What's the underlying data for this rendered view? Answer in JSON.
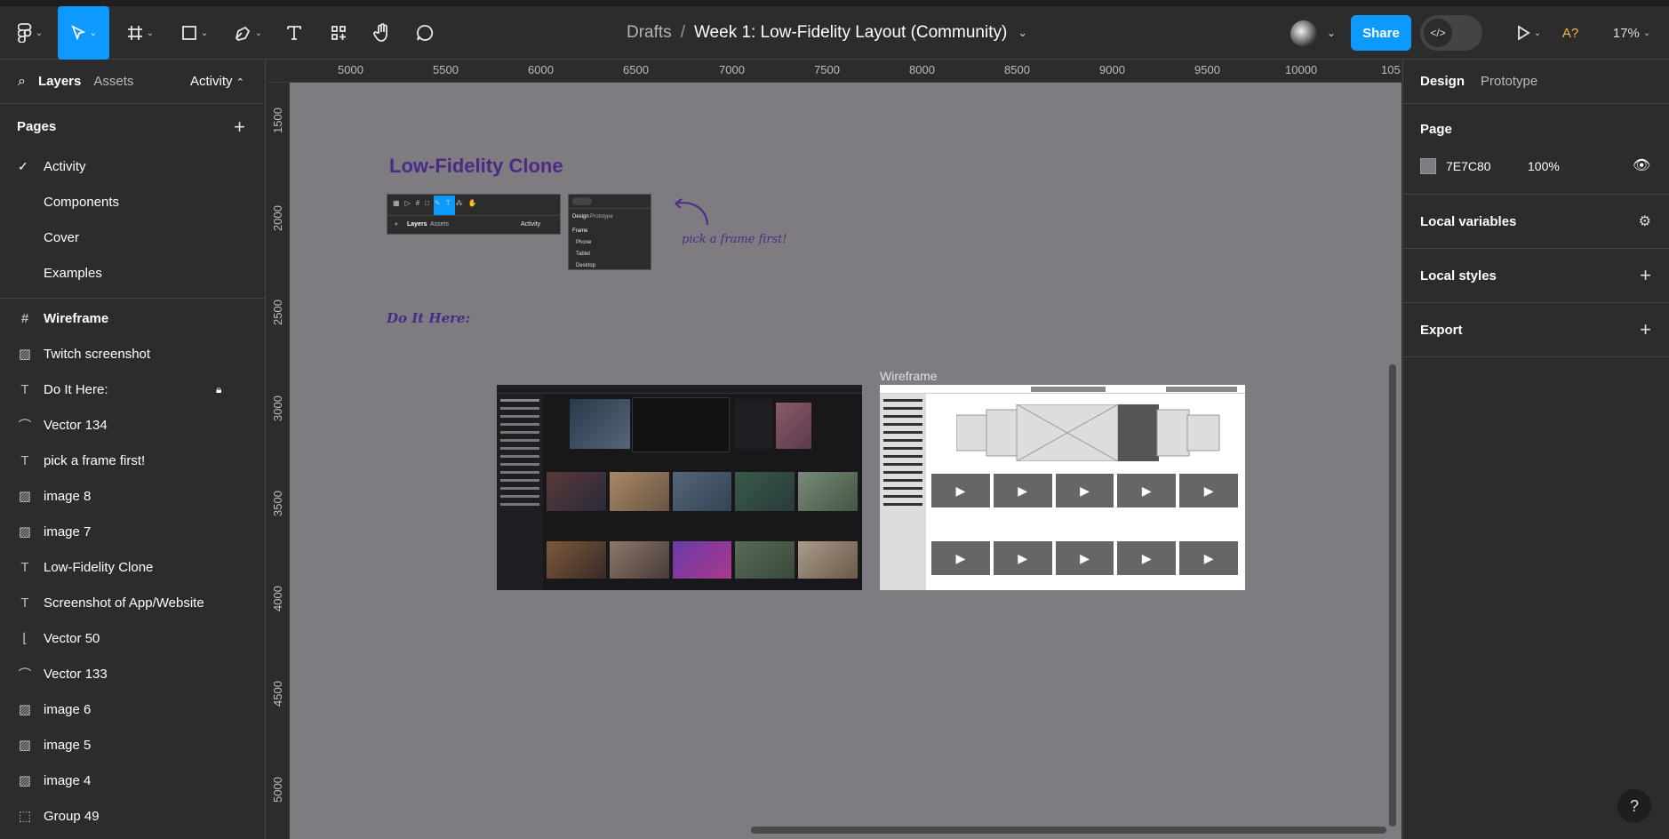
{
  "topbar": {
    "breadcrumb_parent": "Drafts",
    "breadcrumb_sep": "/",
    "file_name": "Week 1: Low-Fidelity Layout (Community)",
    "share_label": "Share",
    "a11y_label": "A?",
    "zoom": "17%",
    "accent": "#0d99ff"
  },
  "left_panel": {
    "tabs": {
      "layers": "Layers",
      "assets": "Assets",
      "page_switch": "Activity"
    },
    "pages_title": "Pages",
    "pages": [
      {
        "label": "Activity",
        "active": true
      },
      {
        "label": "Components"
      },
      {
        "label": "Cover"
      },
      {
        "label": "Examples"
      }
    ],
    "layers": [
      {
        "label": "Wireframe",
        "icon": "frame-icon",
        "bold": true
      },
      {
        "label": "Twitch screenshot",
        "icon": "image-icon"
      },
      {
        "label": "Do It Here:",
        "icon": "text-icon",
        "locked": true
      },
      {
        "label": "Vector 134",
        "icon": "vector-icon"
      },
      {
        "label": "pick a frame first!",
        "icon": "text-icon"
      },
      {
        "label": "image 8",
        "icon": "image-icon"
      },
      {
        "label": "image 7",
        "icon": "image-icon"
      },
      {
        "label": "Low-Fidelity Clone",
        "icon": "text-icon"
      },
      {
        "label": "Screenshot of App/Website",
        "icon": "text-icon"
      },
      {
        "label": "Vector 50",
        "icon": "vector-icon"
      },
      {
        "label": "Vector 133",
        "icon": "vector-icon"
      },
      {
        "label": "image 6",
        "icon": "image-icon"
      },
      {
        "label": "image 5",
        "icon": "image-icon"
      },
      {
        "label": "image 4",
        "icon": "image-icon"
      },
      {
        "label": "Group 49",
        "icon": "group-icon"
      }
    ]
  },
  "rulers": {
    "horizontal": [
      "5000",
      "5500",
      "6000",
      "6500",
      "7000",
      "7500",
      "8000",
      "8500",
      "9000",
      "9500",
      "10000",
      "105"
    ],
    "vertical": [
      "1500",
      "2000",
      "2500",
      "3000",
      "3500",
      "4000",
      "4500",
      "5000"
    ]
  },
  "canvas": {
    "background": "#7E7C80",
    "title": "Low-Fidelity Clone",
    "handwritten_note": "pick a frame first!",
    "do_it_here": "Do It Here:",
    "wireframe_label": "Wireframe",
    "mini_toolbar": {
      "layers": "Layers",
      "assets": "Assets",
      "activity": "Activity"
    },
    "mini_panel": {
      "design": "Design",
      "prototype": "Prototype",
      "frame": "Frame",
      "items": [
        "Phone",
        "Tablet",
        "Desktop"
      ]
    }
  },
  "right_panel": {
    "tabs": {
      "design": "Design",
      "prototype": "Prototype"
    },
    "page_section": "Page",
    "page_color": "7E7C80",
    "page_opacity": "100%",
    "local_variables": "Local variables",
    "local_styles": "Local styles",
    "export": "Export"
  },
  "help_label": "?"
}
